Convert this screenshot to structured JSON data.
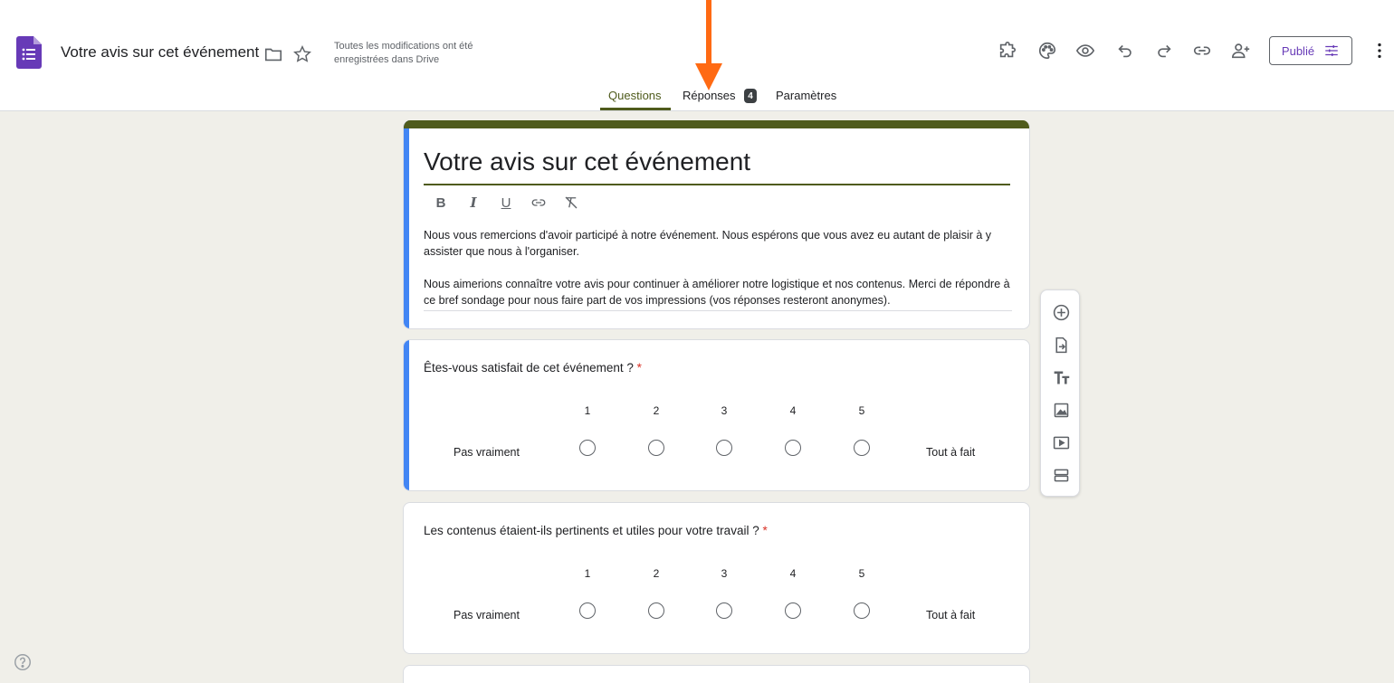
{
  "header": {
    "doc_title": "Votre avis sur cet événement",
    "save_status": "Toutes les modifications ont été enregistrées dans Drive",
    "publish_label": "Publié",
    "accent_color": "#673ab7"
  },
  "tabs": {
    "questions": "Questions",
    "responses": "Réponses",
    "responses_count": "4",
    "settings": "Paramètres"
  },
  "form": {
    "title": "Votre avis sur cet événement",
    "desc_p1": "Nous vous remercions d'avoir participé à notre événement. Nous espérons que vous avez eu autant de plaisir à y assister que nous à l'organiser.",
    "desc_p2": "Nous aimerions connaître votre avis pour continuer à améliorer notre logistique et nos contenus. Merci de répondre à ce bref sondage pour nous faire part de vos impressions (vos réponses resteront anonymes).",
    "theme_color": "#4f5b1c"
  },
  "questions": [
    {
      "text": "Êtes-vous satisfait de cet événement ?",
      "required": "*",
      "scale": [
        "1",
        "2",
        "3",
        "4",
        "5"
      ],
      "low_label": "Pas vraiment",
      "high_label": "Tout à fait"
    },
    {
      "text": "Les contenus étaient-ils pertinents et utiles pour votre travail ?",
      "required": "*",
      "scale": [
        "1",
        "2",
        "3",
        "4",
        "5"
      ],
      "low_label": "Pas vraiment",
      "high_label": "Tout à fait"
    }
  ],
  "format_toolbar": {
    "bold": "B",
    "italic": "I",
    "underline": "U"
  }
}
